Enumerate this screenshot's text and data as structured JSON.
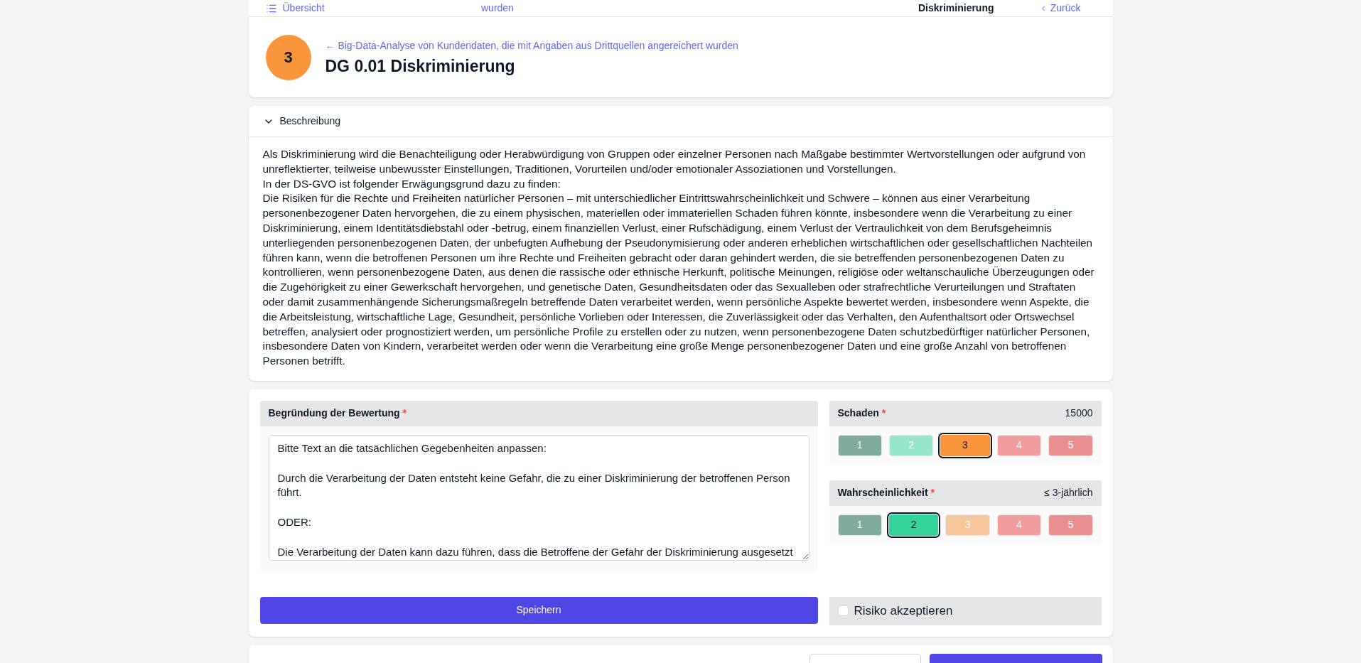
{
  "top_strip": {
    "items": [
      {
        "text": "Übersicht",
        "kind": "link"
      },
      {
        "text": "wurden",
        "kind": "link"
      },
      {
        "text": "Diskriminierung",
        "kind": "current"
      },
      {
        "text": "Zurück",
        "kind": "back"
      }
    ]
  },
  "header": {
    "badge": "3",
    "breadcrumb": "← Big-Data-Analyse von Kundendaten, die mit Angaben aus Drittquellen angereichert wurden",
    "title": "DG 0.01 Diskriminierung"
  },
  "description": {
    "title": "Beschreibung",
    "expanded": true,
    "lines": [
      "Als Diskriminierung wird die Benachteiligung oder Herabwürdigung von Gruppen oder einzelner Personen nach Maßgabe bestimmter Wertvorstellungen oder aufgrund von unreflektierter, teilweise unbewusster Einstellungen, Traditionen, Vorurteilen und/oder emotionaler Assoziationen und Vorstellungen.",
      "In der DS-GVO ist folgender Erwägungsgrund dazu zu finden:",
      "Die Risiken für die Rechte und Freiheiten natürlicher Personen – mit unterschiedlicher Eintrittswahrscheinlichkeit und Schwere – können aus einer Verarbeitung personenbezogener Daten hervorgehen, die zu einem physischen, materiellen oder immateriellen Schaden führen könnte, insbesondere wenn die Verarbeitung zu einer Diskriminierung, einem Identitätsdiebstahl oder -betrug, einem finanziellen Verlust, einer Rufschädigung, einem Verlust der Vertraulichkeit von dem Berufsgeheimnis unterliegenden personenbezogenen Daten, der unbefugten Aufhebung der Pseudonymisierung oder anderen erheblichen wirtschaftlichen oder gesellschaftlichen Nachteilen führen kann, wenn die betroffenen Personen um ihre Rechte und Freiheiten gebracht oder daran gehindert werden, die sie betreffenden personenbezogenen Daten zu kontrollieren, wenn personenbezogene Daten, aus denen die rassische oder ethnische Herkunft, politische Meinungen, religiöse oder weltanschauliche Überzeugungen oder die Zugehörigkeit zu einer Gewerkschaft hervorgehen, und genetische Daten, Gesundheitsdaten oder das Sexualleben oder strafrechtliche Verurteilungen und Straftaten oder damit zusammenhängende Sicherungsmaßregeln betreffende Daten verarbeitet werden, wenn persönliche Aspekte bewertet werden, insbesondere wenn Aspekte, die die Arbeitsleistung, wirtschaftliche Lage, Gesundheit, persönliche Vorlieben oder Interessen, die Zuverlässigkeit oder das Verhalten, den Aufenthaltsort oder Ortswechsel betreffen, analysiert oder prognostiziert werden, um persönliche Profile zu erstellen oder zu nutzen, wenn personenbezogene Daten schutzbedürftiger natürlicher Personen, insbesondere Daten von Kindern, verarbeitet werden oder wenn die Verarbeitung eine große Menge personenbezogener Daten und eine große Anzahl von betroffenen Personen betrifft."
    ]
  },
  "justification": {
    "label": "Begründung der Bewertung",
    "required_mark": "*",
    "value": "Bitte Text an die tatsächlichen Gegebenheiten anpassen:\n\nDurch die Verarbeitung der Daten entsteht keine Gefahr, die zu einer Diskriminierung der betroffenen Person führt.\n\nODER:\n\nDie Verarbeitung der Daten kann dazu führen, dass die Betroffene der Gefahr der Diskriminierung ausgesetzt"
  },
  "ratings": [
    {
      "label": "Schaden",
      "required_mark": "*",
      "reading": "15000",
      "options": [
        {
          "label": "1",
          "selected": false,
          "color": "#7fab9c"
        },
        {
          "label": "2",
          "selected": false,
          "color": "#96e6c9"
        },
        {
          "label": "3",
          "selected": true,
          "color": "#fb953d"
        },
        {
          "label": "4",
          "selected": false,
          "color": "#f29e9e"
        },
        {
          "label": "5",
          "selected": false,
          "color": "#e98f8f"
        }
      ]
    },
    {
      "label": "Wahrscheinlichkeit",
      "required_mark": "*",
      "reading": "≤ 3-jährlich",
      "options": [
        {
          "label": "1",
          "selected": false,
          "color": "#7fab9c"
        },
        {
          "label": "2",
          "selected": true,
          "color": "#34d399"
        },
        {
          "label": "3",
          "selected": false,
          "color": "#f8c69b"
        },
        {
          "label": "4",
          "selected": false,
          "color": "#f29e9e"
        },
        {
          "label": "5",
          "selected": false,
          "color": "#e98f8f"
        }
      ]
    }
  ],
  "save_button": "Speichern",
  "accept_risk": {
    "label": "Risiko akzeptieren",
    "checked": false
  }
}
